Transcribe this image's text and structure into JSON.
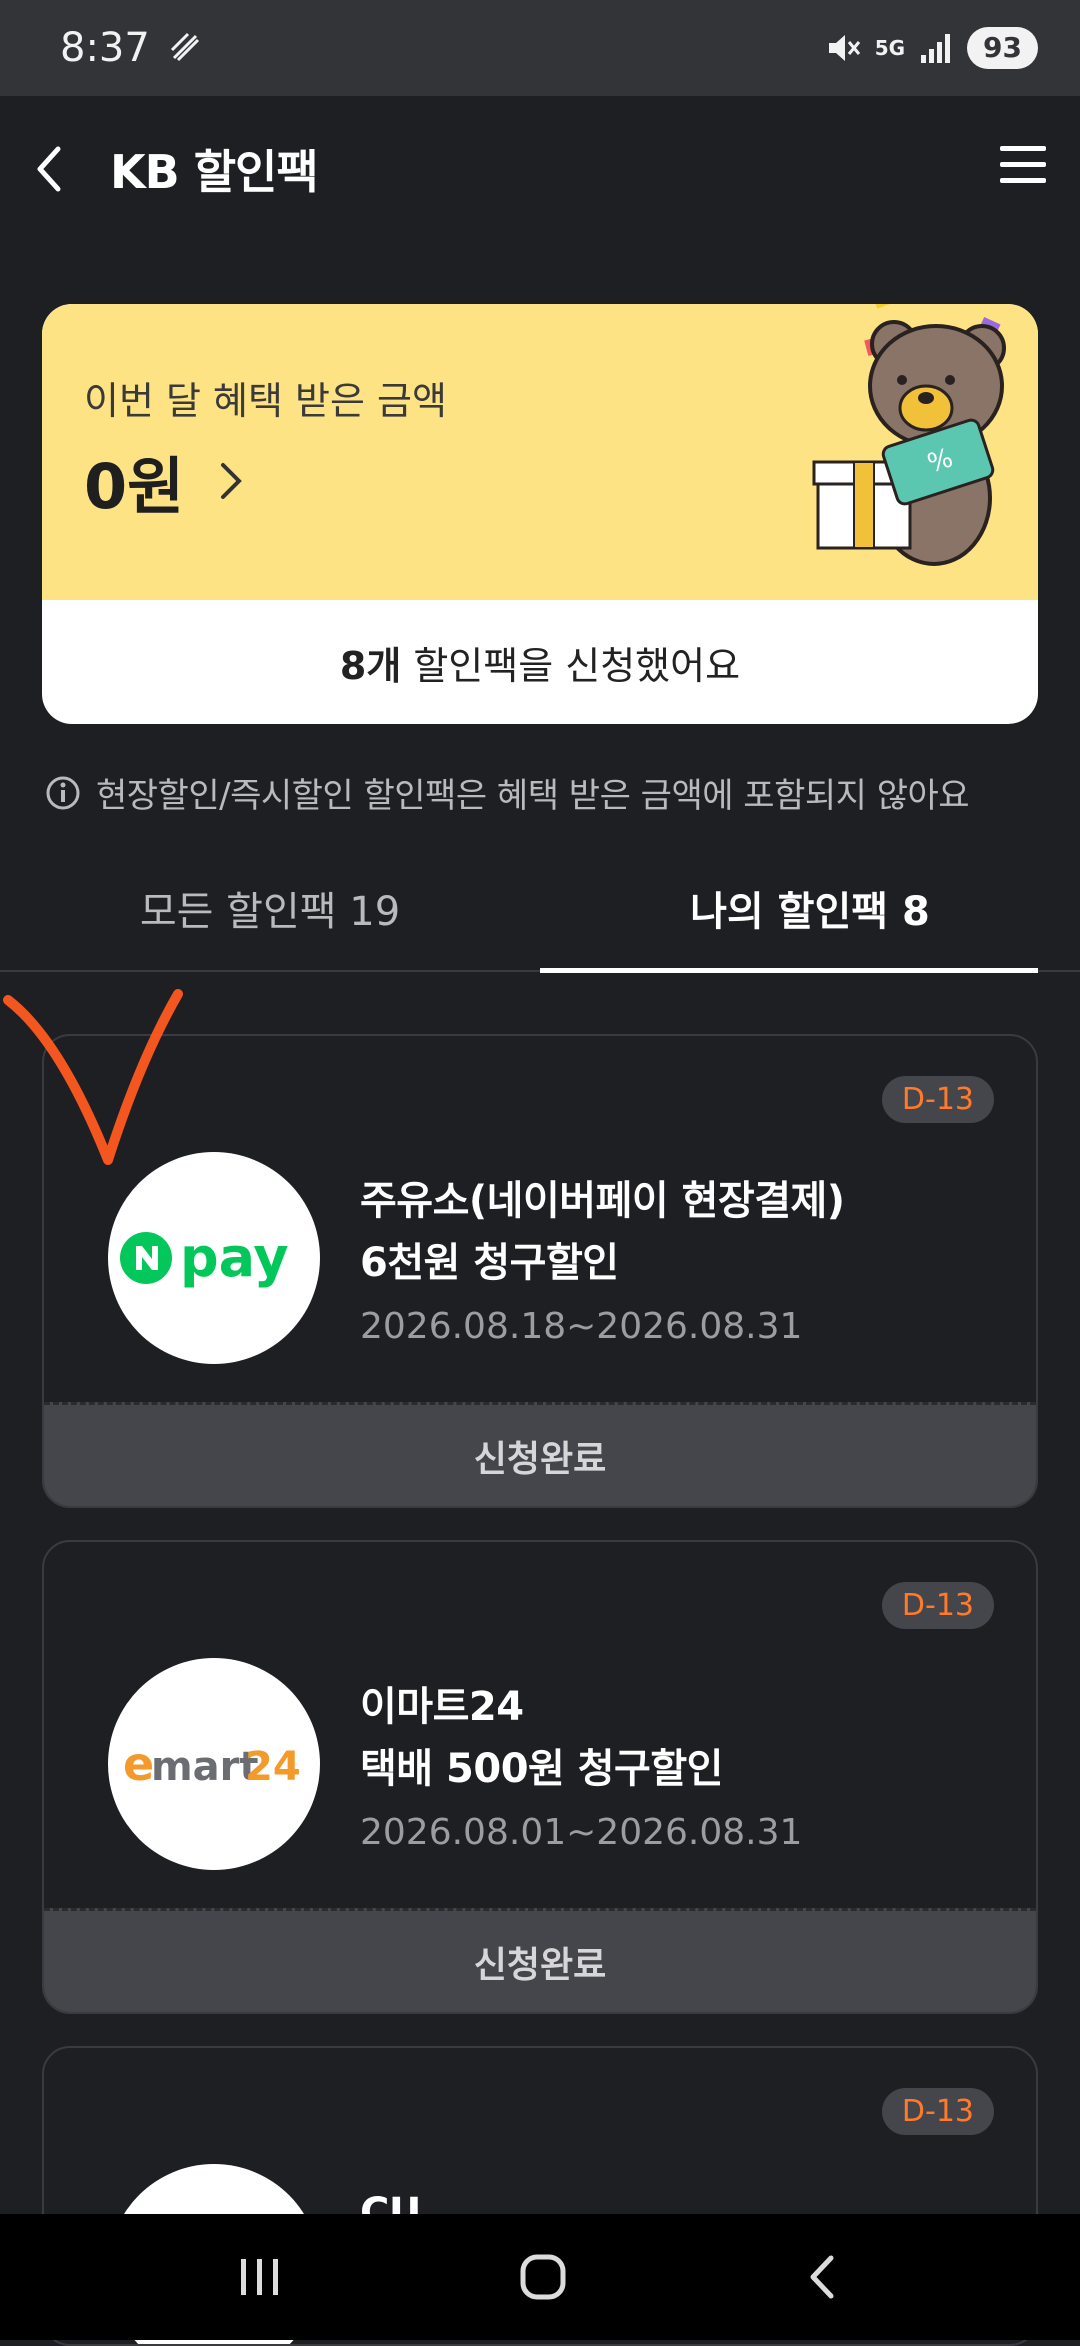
{
  "status_bar": {
    "time": "8:37",
    "network": "5G",
    "battery": "93"
  },
  "header": {
    "title": "KB 할인팩"
  },
  "benefit_card": {
    "label": "이번 달 혜택 받은 금액",
    "amount": "0원",
    "applied_count": "8개",
    "applied_text": "할인팩을 신청했어요"
  },
  "notice": "현장할인/즉시할인 할인팩은 혜택 받은 금액에 포함되지 않아요",
  "tabs": [
    {
      "label": "모든 할인팩 19",
      "active": false
    },
    {
      "label": "나의 할인팩 8",
      "active": true
    }
  ],
  "packs": [
    {
      "dday": "D-13",
      "logo": "npay",
      "title_line1": "주유소(네이버페이 현장결제)",
      "title_line2": "6천원 청구할인",
      "period": "2026.08.18~2026.08.31",
      "status": "신청완료"
    },
    {
      "dday": "D-13",
      "logo": "emart24",
      "title_line1": "이마트24",
      "title_line2": "택배 500원 청구할인",
      "period": "2026.08.01~2026.08.31",
      "status": "신청완료"
    },
    {
      "dday": "D-13",
      "logo": "cu",
      "title_line1": "CU"
    }
  ],
  "colors": {
    "background": "#1e1f23",
    "card_yellow": "#fde384",
    "dday_orange": "#ff7a2a",
    "npay_green": "#03c75a",
    "emart_orange": "#f39a2b"
  }
}
